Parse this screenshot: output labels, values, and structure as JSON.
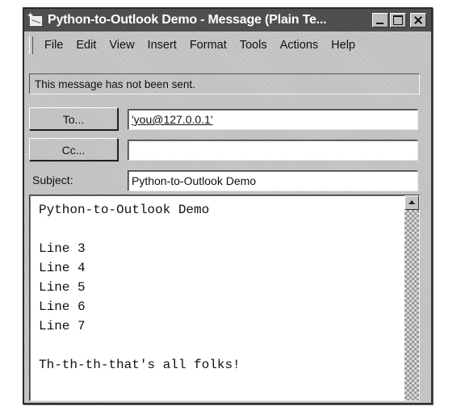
{
  "window": {
    "title": "Python-to-Outlook Demo - Message (Plain Te..."
  },
  "menu": {
    "items": [
      {
        "label": "File",
        "name": "menu-file"
      },
      {
        "label": "Edit",
        "name": "menu-edit"
      },
      {
        "label": "View",
        "name": "menu-view"
      },
      {
        "label": "Insert",
        "name": "menu-insert"
      },
      {
        "label": "Format",
        "name": "menu-format"
      },
      {
        "label": "Tools",
        "name": "menu-tools"
      },
      {
        "label": "Actions",
        "name": "menu-actions"
      },
      {
        "label": "Help",
        "name": "menu-help"
      }
    ]
  },
  "notice": "This message has not been sent.",
  "to": {
    "button_label": "To...",
    "value": "'you@127.0.0.1'"
  },
  "cc": {
    "button_label": "Cc...",
    "value": ""
  },
  "subject": {
    "label": "Subject:",
    "value": "Python-to-Outlook Demo"
  },
  "message_body": [
    "Python-to-Outlook Demo",
    "",
    "Line 3",
    "Line 4",
    "Line 5",
    "Line 6",
    "Line 7",
    "",
    "Th-th-th-that's all folks!"
  ]
}
